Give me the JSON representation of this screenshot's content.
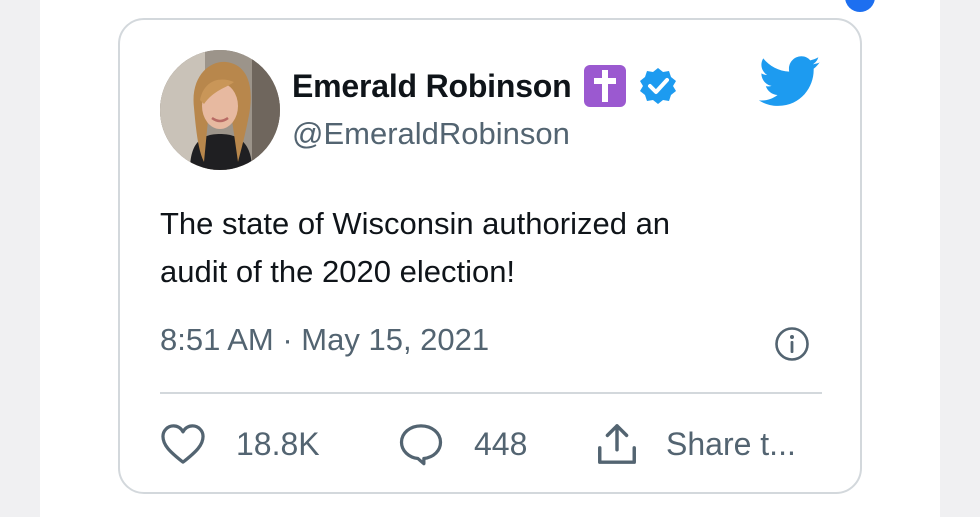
{
  "tweet": {
    "author": {
      "display_name": "Emerald Robinson",
      "handle": "@EmeraldRobinson",
      "name_emoji": "latin-cross-emoji",
      "verified": true
    },
    "text_line1": "The state of Wisconsin authorized an",
    "text_line2": "audit of the 2020 election!",
    "timestamp": "8:51 AM · May 15, 2021",
    "actions": {
      "like_count": "18.8K",
      "reply_count": "448",
      "share_label": "Share t..."
    }
  },
  "icons": {
    "brand": "twitter-bird-icon",
    "verified": "verified-badge-icon",
    "info": "info-icon",
    "like": "heart-icon",
    "reply": "comment-bubble-icon",
    "share": "share-upload-icon"
  },
  "colors": {
    "text_primary": "#0f1419",
    "text_secondary": "#536471",
    "twitter_blue": "#1d9bf0",
    "border": "#d3d8dc",
    "cross_emoji_bg": "#9b59d0"
  }
}
